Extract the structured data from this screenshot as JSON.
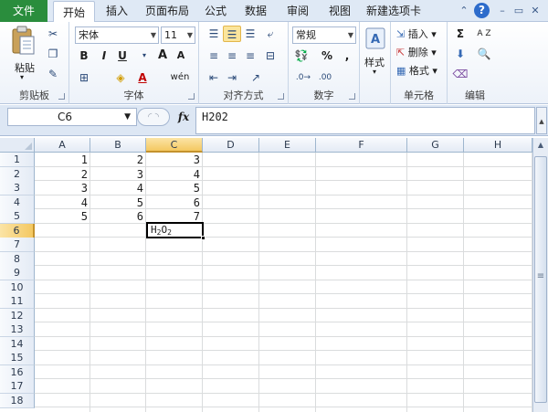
{
  "tabs": [
    "文件",
    "开始",
    "插入",
    "页面布局",
    "公式",
    "数据",
    "审阅",
    "视图",
    "新建选项卡"
  ],
  "window_icons": [
    "⌃",
    "?",
    "–",
    "▭",
    "✕"
  ],
  "ribbon": {
    "clipboard": {
      "paste_label": "粘贴",
      "group_label": "剪贴板"
    },
    "font": {
      "font_name": "宋体",
      "font_size": "11",
      "bold": "B",
      "italic": "I",
      "underline": "U",
      "grow": "A",
      "shrink": "A",
      "font_color_letter": "A",
      "wen": "wén",
      "group_label": "字体"
    },
    "alignment": {
      "group_label": "对齐方式"
    },
    "number": {
      "format": "常规",
      "percent": "%",
      "comma": ",",
      "group_label": "数字"
    },
    "styles": {
      "label": "样式"
    },
    "cells": {
      "insert": "插入",
      "delete": "删除",
      "format": "格式",
      "group_label": "单元格"
    },
    "editing": {
      "sigma": "Σ",
      "sort": "A Z",
      "group_label": "编辑"
    }
  },
  "formula_bar": {
    "name_box": "C6",
    "fx": "fx",
    "value": "H202"
  },
  "grid": {
    "columns": [
      "A",
      "B",
      "C",
      "D",
      "E",
      "F",
      "G",
      "H"
    ],
    "selected_column": "C",
    "rows": [
      "1",
      "2",
      "3",
      "4",
      "5",
      "6",
      "7",
      "8",
      "9",
      "10",
      "11",
      "12",
      "13",
      "14",
      "15",
      "16",
      "17",
      "18"
    ],
    "selected_row": "6",
    "data": [
      [
        "1",
        "2",
        "3"
      ],
      [
        "2",
        "3",
        "4"
      ],
      [
        "3",
        "4",
        "5"
      ],
      [
        "4",
        "5",
        "6"
      ],
      [
        "5",
        "6",
        "7"
      ]
    ],
    "active_cell": {
      "base": "H",
      "sub1": "2",
      "mid": "O",
      "sub2": "2"
    }
  }
}
